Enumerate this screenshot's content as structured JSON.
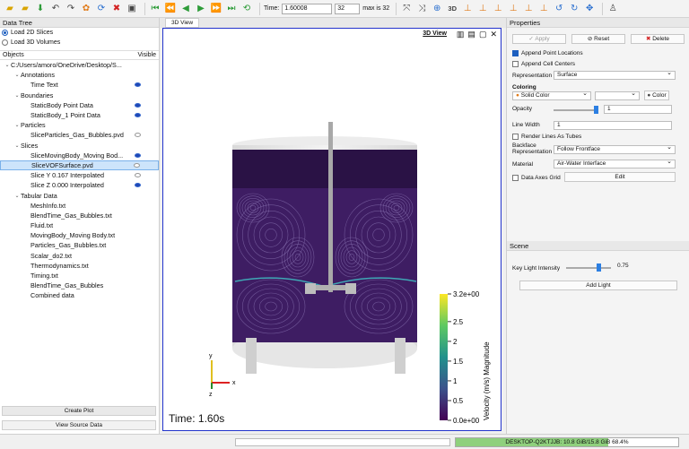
{
  "toolbar": {
    "time_label": "Time:",
    "time_value": "1.60008",
    "timestep_value": "32",
    "max_label": "max is 32",
    "view_3d": "3D"
  },
  "left": {
    "title": "Data Tree",
    "load_2d": "Load 2D Slices",
    "load_3d": "Load 3D Volumes",
    "col_objects": "Objects",
    "col_visible": "Visible",
    "tree": [
      {
        "label": "C:/Users/amoro/OneDrive/Desktop/S...",
        "level": 0,
        "arrow": "⌄",
        "eye": ""
      },
      {
        "label": "Annotations",
        "level": 1,
        "arrow": "⌄",
        "eye": ""
      },
      {
        "label": "Time Text",
        "level": 2,
        "arrow": "",
        "eye": "vis"
      },
      {
        "label": "Boundaries",
        "level": 1,
        "arrow": "⌄",
        "eye": ""
      },
      {
        "label": "StaticBody Point Data",
        "level": 2,
        "arrow": "",
        "eye": "vis"
      },
      {
        "label": "StaticBody_1 Point Data",
        "level": 2,
        "arrow": "",
        "eye": "vis"
      },
      {
        "label": "Particles",
        "level": 1,
        "arrow": "⌄",
        "eye": ""
      },
      {
        "label": "SliceParticles_Gas_Bubbles.pvd",
        "level": 2,
        "arrow": "",
        "eye": "off"
      },
      {
        "label": "Slices",
        "level": 1,
        "arrow": "⌄",
        "eye": ""
      },
      {
        "label": "SliceMovingBody_Moving Bod...",
        "level": 2,
        "arrow": "",
        "eye": "vis"
      },
      {
        "label": "SliceVOFSurface.pvd",
        "level": 2,
        "arrow": "",
        "eye": "off",
        "selected": true
      },
      {
        "label": "Slice Y 0.167 Interpolated",
        "level": 2,
        "arrow": "",
        "eye": "off"
      },
      {
        "label": "Slice Z 0.000 Interpolated",
        "level": 2,
        "arrow": "",
        "eye": "vis"
      },
      {
        "label": "Tabular Data",
        "level": 1,
        "arrow": "⌄",
        "eye": ""
      },
      {
        "label": "MeshInfo.txt",
        "level": 2,
        "arrow": "",
        "eye": ""
      },
      {
        "label": "BlendTime_Gas_Bubbles.txt",
        "level": 2,
        "arrow": "",
        "eye": ""
      },
      {
        "label": "Fluid.txt",
        "level": 2,
        "arrow": "",
        "eye": ""
      },
      {
        "label": "MovingBody_Moving Body.txt",
        "level": 2,
        "arrow": "",
        "eye": ""
      },
      {
        "label": "Particles_Gas_Bubbles.txt",
        "level": 2,
        "arrow": "",
        "eye": ""
      },
      {
        "label": "Scalar_do2.txt",
        "level": 2,
        "arrow": "",
        "eye": ""
      },
      {
        "label": "Thermodynamics.txt",
        "level": 2,
        "arrow": "",
        "eye": ""
      },
      {
        "label": "Timing.txt",
        "level": 2,
        "arrow": "",
        "eye": ""
      },
      {
        "label": "BlendTime_Gas_Bubbles",
        "level": 2,
        "arrow": "",
        "eye": ""
      },
      {
        "label": "Combined data",
        "level": 2,
        "arrow": "",
        "eye": ""
      }
    ],
    "create_plot": "Create Plot",
    "view_source": "View Source Data"
  },
  "view": {
    "tab_label": "3D View",
    "title": "3D View",
    "time_text": "Time: 1.60s",
    "colorbar": {
      "title": "Velocity (m/s) Magnitude",
      "ticks": [
        "3.2e+00",
        "2.5",
        "2",
        "1.5",
        "1",
        "0.5",
        "0.0e+00"
      ],
      "tick_values": [
        3.2,
        2.5,
        2.0,
        1.5,
        1.0,
        0.5,
        0.0
      ],
      "range": [
        0.0,
        3.2
      ]
    },
    "axes": {
      "x": "x",
      "y": "y",
      "z": "z"
    },
    "colors": {
      "liquid": "#3e1d63",
      "liquid_dark": "#2a1245",
      "accent": "#2233cc"
    }
  },
  "props": {
    "title": "Properties",
    "apply": "Apply",
    "reset": "Reset",
    "delete": "Delete",
    "append_points": "Append Point Locations",
    "append_cells": "Append Cell Centers",
    "representation_label": "Representation",
    "representation_value": "Surface",
    "coloring_label": "Coloring",
    "coloring_value": "Solid Color",
    "color_btn": "Color",
    "opacity_label": "Opacity",
    "opacity_value": "1",
    "opacity_level": 1.0,
    "line_width_label": "Line Width",
    "line_width_value": "1",
    "render_tubes": "Render Lines As Tubes",
    "backface_label": "Backface\nRepresentation",
    "backface_value": "Follow Frontface",
    "material_label": "Material",
    "material_value": "Air-Water Interface",
    "data_axes_grid": "Data Axes Grid",
    "edit": "Edit"
  },
  "scene": {
    "title": "Scene",
    "key_light_label": "Key Light Intensity",
    "key_light_value": "0.75",
    "key_light_level": 0.75,
    "add_light": "Add Light"
  },
  "status": {
    "memory_text": "DESKTOP-Q2KTJJB: 10.8 GiB/15.8 GiB 68.4%",
    "memory_fraction": 0.684
  }
}
